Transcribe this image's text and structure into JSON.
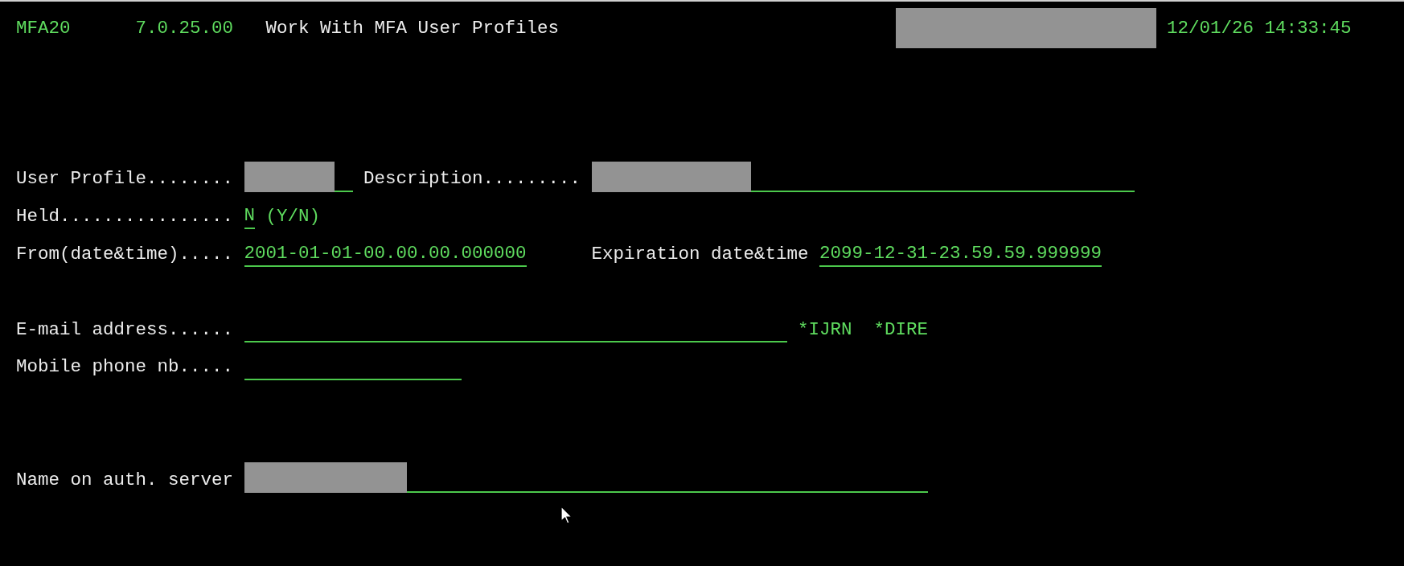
{
  "header": {
    "program": "MFA20",
    "version": "7.0.25.00",
    "title": "Work With MFA User Profiles",
    "system_redacted": true,
    "datetime": "12/01/26 14:33:45"
  },
  "fields": [
    {
      "label": "User Profile........",
      "redacted": true
    },
    {
      "label": "Description.........",
      "redacted": true
    },
    {
      "label": "Held................",
      "value": "N",
      "hint": "(Y/N)"
    },
    {
      "label": "From(date&time).....",
      "value": "2001-01-01-00.00.00.000000"
    },
    {
      "label": "Expiration date&time",
      "value": "2099-12-31-23.59.59.999999"
    },
    {
      "label": "E-mail address......",
      "flags": [
        "*IJRN",
        "*DIRE"
      ]
    },
    {
      "label": "Mobile phone nb....."
    },
    {
      "label": "Name on auth. server",
      "redacted": true
    }
  ]
}
